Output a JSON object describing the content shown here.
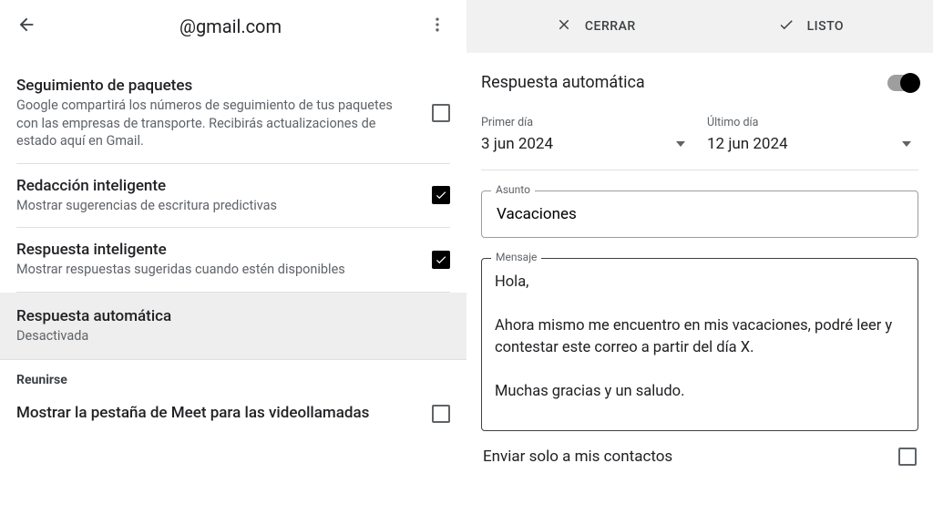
{
  "left": {
    "title": "@gmail.com",
    "items": [
      {
        "title": "Seguimiento de paquetes",
        "sub": "Google compartirá los números de seguimiento de tus paquetes con las empresas de transporte. Recibirás actualizaciones de estado aquí en Gmail.",
        "checked": false
      },
      {
        "title": "Redacción inteligente",
        "sub": "Mostrar sugerencias de escritura predictivas",
        "checked": true
      },
      {
        "title": "Respuesta inteligente",
        "sub": "Mostrar respuestas sugeridas cuando estén disponibles",
        "checked": true
      },
      {
        "title": "Respuesta automática",
        "sub": "Desactivada",
        "highlight": true
      }
    ],
    "meet_header": "Reunirse",
    "meet_item": {
      "title": "Mostrar la pestaña de Meet para las videollamadas",
      "checked": false
    }
  },
  "right": {
    "close": "CERRAR",
    "done": "LISTO",
    "toggle_label": "Respuesta automática",
    "toggle_on": true,
    "first_day_label": "Primer día",
    "first_day_value": "3 jun 2024",
    "last_day_label": "Último día",
    "last_day_value": "12 jun 2024",
    "subject_label": "Asunto",
    "subject_value": "Vacaciones",
    "message_label": "Mensaje",
    "message_value": "Hola,\n\nAhora mismo me encuentro en mis vacaciones, podré leer y contestar este correo a partir del día X.\n\nMuchas gracias y un saludo.",
    "contacts_only": "Enviar solo a mis contactos",
    "contacts_checked": false
  }
}
